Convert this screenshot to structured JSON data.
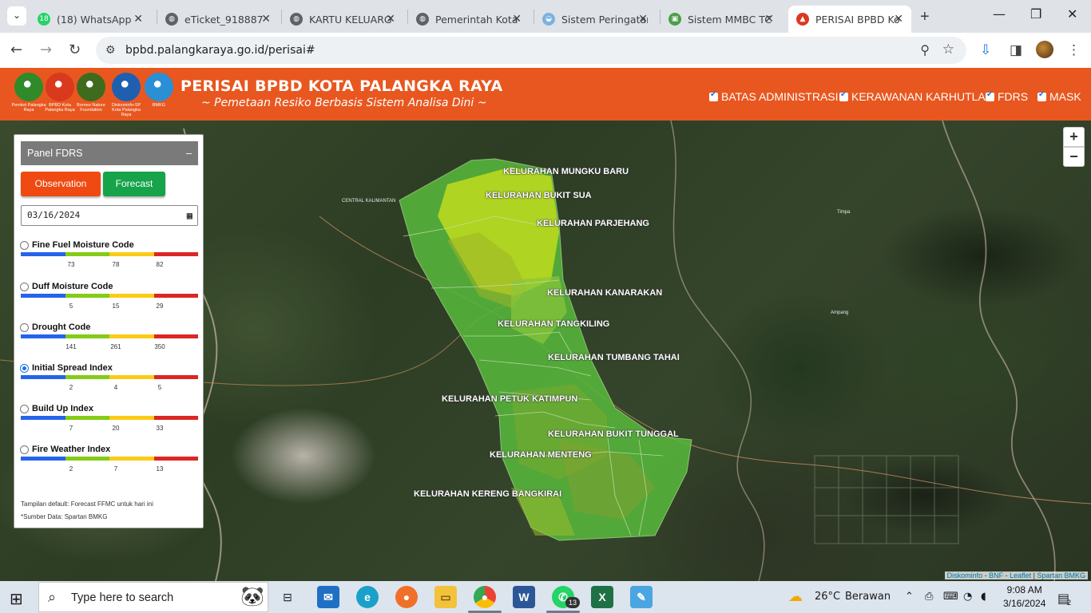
{
  "browser": {
    "tabs": [
      {
        "title": "(18) WhatsApp",
        "fav": "#25d366",
        "glyph": "18"
      },
      {
        "title": "eTicket_918887",
        "fav": "#5f6368",
        "glyph": "◍"
      },
      {
        "title": "KARTU KELUARG",
        "fav": "#5f6368",
        "glyph": "◍"
      },
      {
        "title": "Pemerintah Kota",
        "fav": "#5f6368",
        "glyph": "◍"
      },
      {
        "title": "Sistem Peringatan",
        "fav": "#7ab2e0",
        "glyph": "◒"
      },
      {
        "title": "Sistem MMBC TC",
        "fav": "#4b9e47",
        "glyph": "▣"
      },
      {
        "title": "PERISAI BPBD Ko",
        "fav": "#d93a1f",
        "glyph": "▲"
      }
    ],
    "url": "bpbd.palangkaraya.go.id/perisai#"
  },
  "header": {
    "title": "PERISAI BPBD KOTA PALANGKA RAYA",
    "subtitle": "~ Pemetaan Resiko Berbasis Sistem Analisa Dini ~",
    "logos": [
      {
        "caption": "Pemkot Palangka Raya",
        "color": "#2f8a2a"
      },
      {
        "caption": "BPBD Kota Palangka Raya",
        "color": "#d9391c"
      },
      {
        "caption": "Borneo Nature Foundation",
        "color": "#3f6b1e"
      },
      {
        "caption": "Diskominfo-SP Kota Palangka Raya",
        "color": "#1f5fb0"
      },
      {
        "caption": "BMKG",
        "color": "#2a8fd4"
      }
    ],
    "layers": [
      "BATAS ADMINISTRASI",
      "KERAWANAN KARHUTLA",
      "FDRS",
      "MASK"
    ]
  },
  "panel": {
    "title": "Panel FDRS",
    "minimize": "–",
    "observation_label": "Observation",
    "forecast_label": "Forecast",
    "date_value": "03/16/2024",
    "indices": [
      {
        "label": "Fine Fuel Moisture Code",
        "ticks": [
          "73",
          "78",
          "82"
        ],
        "selected": false
      },
      {
        "label": "Duff Moisture Code",
        "ticks": [
          "5",
          "15",
          "29"
        ],
        "selected": false
      },
      {
        "label": "Drought Code",
        "ticks": [
          "141",
          "261",
          "350"
        ],
        "selected": false
      },
      {
        "label": "Initial Spread Index",
        "ticks": [
          "2",
          "4",
          "5"
        ],
        "selected": true
      },
      {
        "label": "Build Up Index",
        "ticks": [
          "7",
          "20",
          "33"
        ],
        "selected": false
      },
      {
        "label": "Fire Weather Index",
        "ticks": [
          "2",
          "7",
          "13"
        ],
        "selected": false
      }
    ],
    "scale_colors": [
      "#2563eb",
      "#84cc16",
      "#facc15",
      "#dc2626"
    ],
    "note_default": "Tampilan default: Forecast FFMC untuk hari ini",
    "note_source": "*Sumber Data: Spartan BMKG"
  },
  "map": {
    "kelurahan": [
      "KELURAHAN MUNGKU BARU",
      "KELURAHAN BUKIT SUA",
      "KELURAHAN PARJEHANG",
      "KELURAHAN KANARAKAN",
      "KELURAHAN TANGKILING",
      "KELURAHAN TUMBANG TAHAI",
      "KELURAHAN PETUK KATIMPUN",
      "KELURAHAN BUKIT TUNGGAL",
      "KELURAHAN MENTENG",
      "KELURAHAN KERENG BANGKIRAI"
    ],
    "places": [
      "CENTRAL KALIMANTAN",
      "Timpa",
      "Ampang"
    ],
    "zoom_in": "+",
    "zoom_out": "−",
    "attribution": {
      "a": "Diskominfo",
      "b": "BNF",
      "c": "Leaflet",
      "d": "Spartan BMKG",
      "sep": " - ",
      "sep2": " | "
    }
  },
  "taskbar": {
    "search_placeholder": "Type here to search",
    "weather_temp": "26°C",
    "weather_text": "Berawan",
    "time": "9:08 AM",
    "date": "3/16/2024",
    "notif_count": "2",
    "whatsapp_badge": "13"
  }
}
